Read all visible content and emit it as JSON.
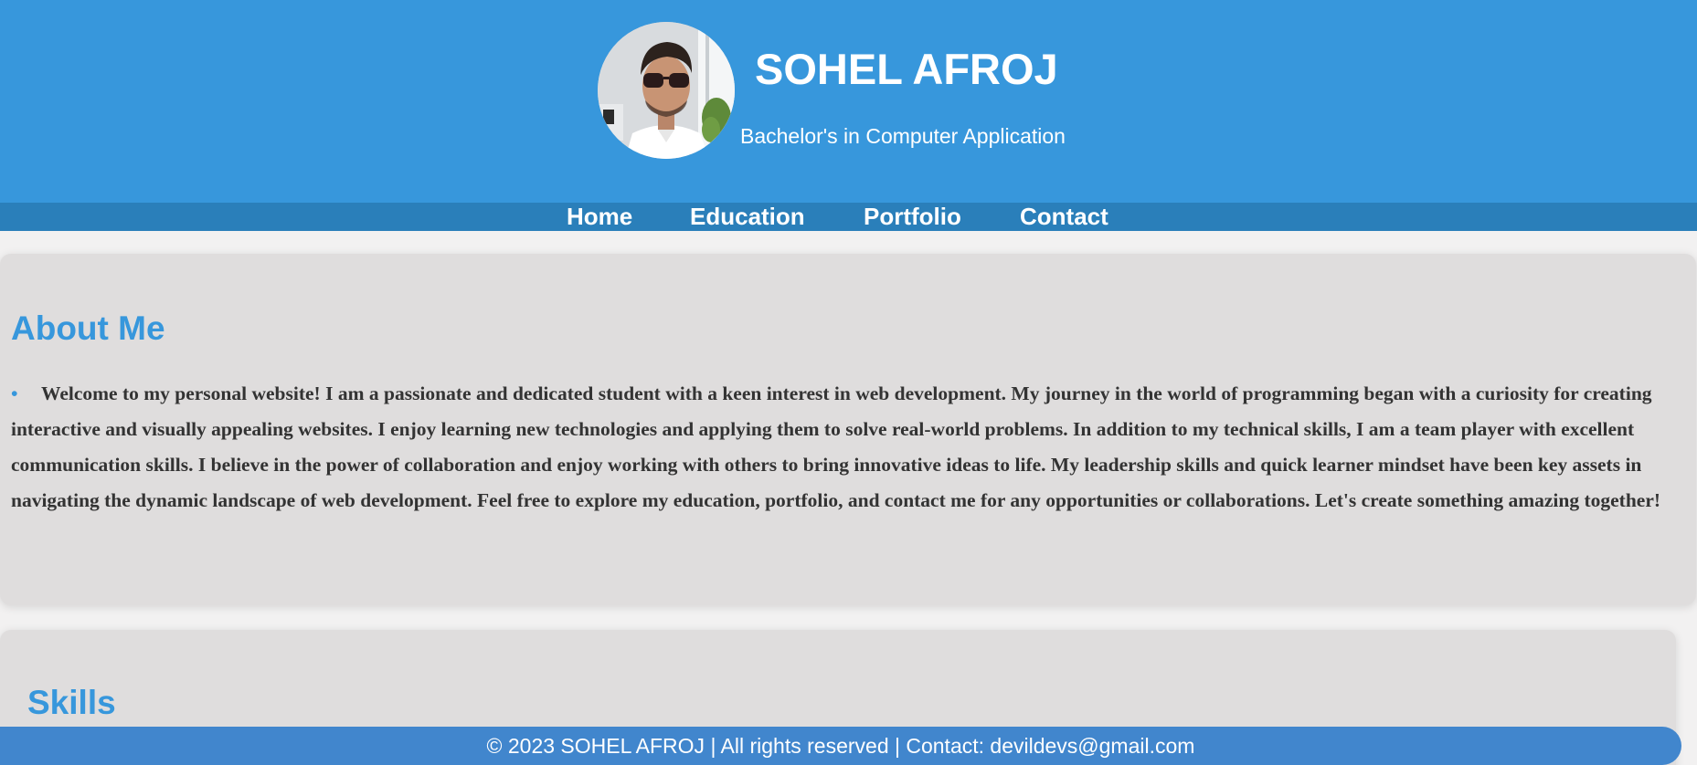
{
  "header": {
    "name": "SOHEL AFROJ",
    "tagline": "Bachelor's in Computer Application"
  },
  "nav": {
    "items": [
      {
        "label": "Home"
      },
      {
        "label": "Education"
      },
      {
        "label": "Portfolio"
      },
      {
        "label": "Contact"
      }
    ]
  },
  "about": {
    "title": "About Me",
    "bullet": "•",
    "text": "Welcome to my personal website! I am a passionate and dedicated student with a keen interest in web development. My journey in the world of programming began with a curiosity for creating interactive and visually appealing websites. I enjoy learning new technologies and applying them to solve real-world problems. In addition to my technical skills, I am a team player with excellent communication skills. I believe in the power of collaboration and enjoy working with others to bring innovative ideas to life. My leadership skills and quick learner mindset have been key assets in navigating the dynamic landscape of web development. Feel free to explore my education, portfolio, and contact me for any opportunities or collaborations. Let's create something amazing together!"
  },
  "skills": {
    "title": "Skills"
  },
  "footer": {
    "text": "© 2023 SOHEL AFROJ | All rights reserved | Contact: devildevs@gmail.com"
  },
  "colors": {
    "header_bg": "#3797dc",
    "nav_bg": "#2a7fba",
    "accent": "#3797dc",
    "card_bg": "#dfdddd",
    "footer_bg": "#4186cd"
  }
}
